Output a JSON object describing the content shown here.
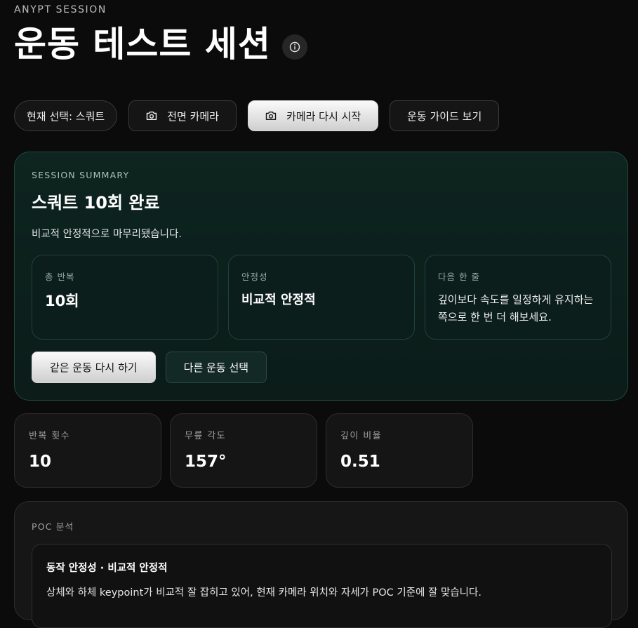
{
  "header": {
    "eyebrow": "ANYPT SESSION",
    "title": "운동 테스트 세션"
  },
  "toolbar": {
    "current_selection": "현재 선택: 스쿼트",
    "front_camera": "전면 카메라",
    "restart_camera": "카메라 다시 시작",
    "exercise_guide": "운동 가이드 보기"
  },
  "summary": {
    "eyebrow": "SESSION SUMMARY",
    "title": "스쿼트 10회 완료",
    "description": "비교적 안정적으로 마무리됐습니다.",
    "cards": [
      {
        "label": "총 반복",
        "value": "10회"
      },
      {
        "label": "안정성",
        "value": "비교적 안정적"
      },
      {
        "label": "다음 한 줄",
        "value": "깊이보다 속도를 일정하게 유지하는 쪽으로 한 번 더 해보세요."
      }
    ],
    "actions": {
      "repeat": "같은 운동 다시 하기",
      "choose_other": "다른 운동 선택"
    }
  },
  "stats": [
    {
      "label": "반복 횟수",
      "value": "10"
    },
    {
      "label": "무릎 각도",
      "value": "157°"
    },
    {
      "label": "깊이 비율",
      "value": "0.51"
    }
  ],
  "poc": {
    "eyebrow": "POC 분석",
    "item_title": "동작 안정성 · 비교적 안정적",
    "item_desc": "상체와 하체 keypoint가 비교적 잘 잡히고 있어, 현재 카메라 위치와 자세가 POC 기준에 잘 맞습니다."
  },
  "icons": {
    "info": "info-icon",
    "camera": "camera-icon"
  },
  "colors": {
    "background": "#0b0b0b",
    "summary_bg": "#0d241f",
    "summary_border": "#1f4a3e",
    "card_bg": "#151515"
  }
}
